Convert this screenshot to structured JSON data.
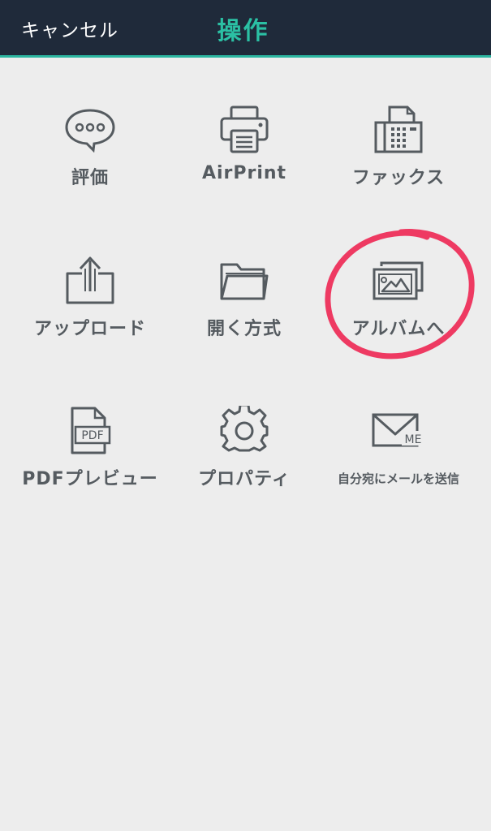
{
  "navbar": {
    "cancel_label": "キャンセル",
    "title": "操作",
    "background_color": "#1f2a3a",
    "accent_color": "#2bb6a0"
  },
  "actions": [
    {
      "label": "評価",
      "icon": "speech-bubble-icon"
    },
    {
      "label": "AirPrint",
      "icon": "printer-icon"
    },
    {
      "label": "ファックス",
      "icon": "fax-icon"
    },
    {
      "label": "アップロード",
      "icon": "upload-icon"
    },
    {
      "label": "開く方式",
      "icon": "folder-icon"
    },
    {
      "label": "アルバムへ",
      "icon": "photo-album-icon"
    },
    {
      "label": "PDFプレビュー",
      "icon": "pdf-document-icon"
    },
    {
      "label": "プロパティ",
      "icon": "gear-icon"
    },
    {
      "label": "自分宛にメールを送信",
      "icon": "mail-to-me-icon"
    }
  ],
  "annotation": {
    "circle_color": "#ee3a62",
    "highlighted_action": "アルバムへ"
  }
}
